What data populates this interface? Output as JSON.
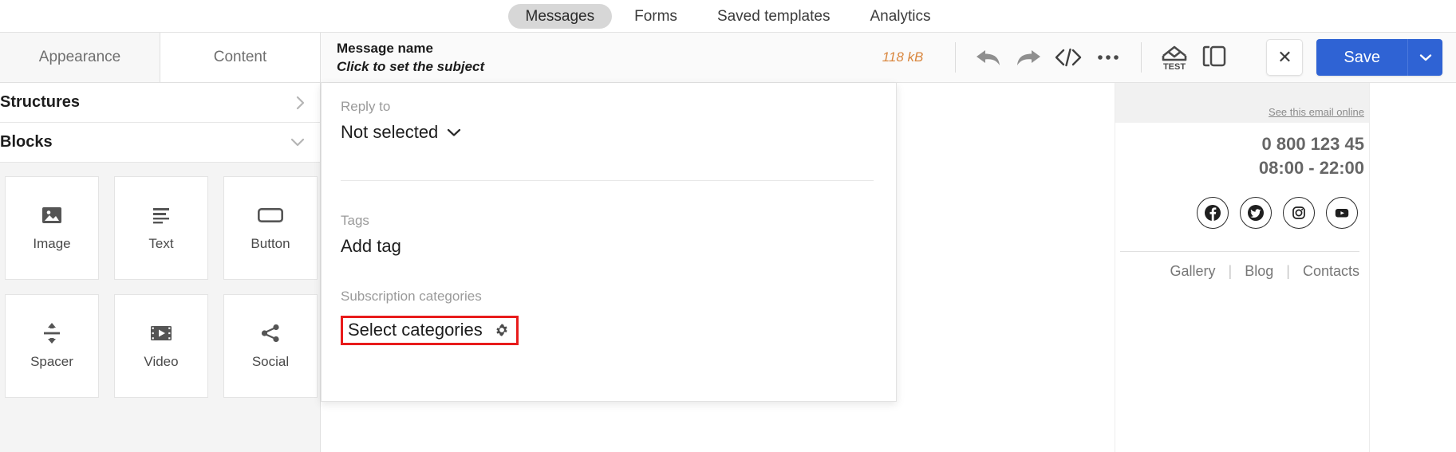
{
  "topnav": {
    "items": [
      {
        "label": "Messages",
        "active": true
      },
      {
        "label": "Forms",
        "active": false
      },
      {
        "label": "Saved templates",
        "active": false
      },
      {
        "label": "Analytics",
        "active": false
      }
    ]
  },
  "left_panel": {
    "tabs": [
      {
        "label": "Appearance",
        "active": false
      },
      {
        "label": "Content",
        "active": true
      }
    ],
    "sections": [
      {
        "label": "Structures",
        "chevron": "chevron-right-icon",
        "glyph": "›"
      },
      {
        "label": "Blocks",
        "chevron": "chevron-down-icon",
        "glyph": "⌄"
      }
    ],
    "blocks": [
      {
        "label": "Image",
        "icon": "image-icon"
      },
      {
        "label": "Text",
        "icon": "text-lines-icon"
      },
      {
        "label": "Button",
        "icon": "button-icon"
      },
      {
        "label": "Spacer",
        "icon": "spacer-icon"
      },
      {
        "label": "Video",
        "icon": "video-icon"
      },
      {
        "label": "Social",
        "icon": "share-icon"
      }
    ]
  },
  "toolbar": {
    "message_name": "Message name",
    "subject_placeholder": "Click to set the subject",
    "size_badge": "118 kB",
    "size_badge_color": "#d9873f",
    "icons": [
      {
        "name": "undo-icon",
        "title": "Undo"
      },
      {
        "name": "redo-icon",
        "title": "Redo"
      },
      {
        "name": "code-icon",
        "title": "HTML code"
      },
      {
        "name": "more-icon",
        "title": "More"
      },
      {
        "name": "test-email-icon",
        "title": "TEST"
      },
      {
        "name": "duplicate-icon",
        "title": "Duplicate"
      }
    ],
    "test_icon_label": "TEST",
    "close_label": "✕",
    "save_label": "Save",
    "save_caret": "⌄",
    "save_color": "#2f63d4"
  },
  "popover": {
    "reply_to": {
      "label": "Reply to",
      "value": "Not selected",
      "caret": "chevron-down-icon"
    },
    "tags": {
      "label": "Tags",
      "value": "Add tag"
    },
    "subscription_categories": {
      "label": "Subscription categories",
      "value": "Select categories",
      "icon": "gear-icon",
      "highlight_color": "#e81b1b"
    }
  },
  "preview": {
    "see_online": "See this email online",
    "phone": "0 800 123 45",
    "hours": "08:00 - 22:00",
    "social": [
      {
        "name": "facebook-icon"
      },
      {
        "name": "twitter-icon"
      },
      {
        "name": "instagram-icon"
      },
      {
        "name": "youtube-icon"
      }
    ],
    "nav": [
      {
        "label": "Gallery"
      },
      {
        "label": "Blog"
      },
      {
        "label": "Contacts"
      }
    ],
    "nav_divider": "|"
  }
}
